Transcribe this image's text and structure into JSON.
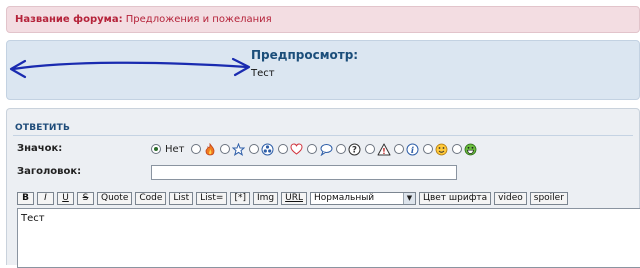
{
  "forum": {
    "label": "Название форума:",
    "name": "Предложения и пожелания"
  },
  "preview": {
    "title": "Предпросмотр:",
    "body": "Тест"
  },
  "reply": {
    "heading": "ОТВЕТИТЬ",
    "icon_label": "Значок:",
    "none_label": "Нет",
    "selected_icon": "none",
    "icons": [
      "flame-icon",
      "star-icon",
      "radioactive-icon",
      "heart-icon",
      "speech-bubble-icon",
      "question-icon",
      "warning-icon",
      "info-icon",
      "smiley-icon",
      "grin-icon"
    ],
    "title_label": "Заголовок:",
    "title_value": "",
    "toolbar": {
      "bold": "B",
      "italic": "I",
      "underline": "U",
      "strike": "S",
      "quote": "Quote",
      "code": "Code",
      "list": "List",
      "list_eq": "List=",
      "list_item": "[*]",
      "img": "Img",
      "url": "URL",
      "size_select": "Нормальный",
      "font_color": "Цвет шрифта",
      "video": "video",
      "spoiler": "spoiler"
    },
    "message": "Тест"
  },
  "colors": {
    "forum_bar_bg": "#f3dde2",
    "preview_bg": "#dbe6f1",
    "reply_bg": "#eceff3",
    "link_red": "#b5233a",
    "heading_blue": "#1f4c7a"
  }
}
